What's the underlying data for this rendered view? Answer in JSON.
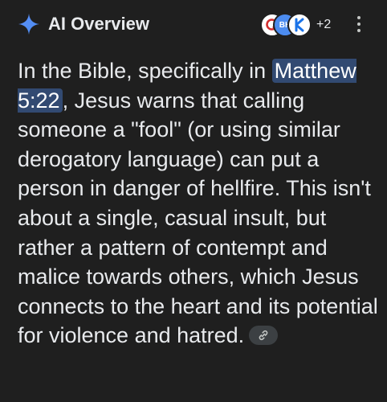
{
  "header": {
    "title": "AI Overview",
    "sources_more_count": "+2",
    "source_icons": [
      "quora-icon",
      "bh-icon",
      "k-icon"
    ],
    "src2_label": "BH"
  },
  "body": {
    "text_before": "In the Bible, specifically in ",
    "reference": "Matthew 5:22",
    "text_after": ", Jesus warns that calling someone a \"fool\" (or using similar derogatory language) can put a person in danger of hellfire. This isn't about a single, casual insult, but rather a pattern of contempt and malice towards others, which Jesus connects to the heart and its potential for violence and hatred."
  },
  "colors": {
    "background": "#1f1f1f",
    "text": "#e8eaed",
    "highlight": "#324a72",
    "spark_blue": "#4c8cf0"
  }
}
